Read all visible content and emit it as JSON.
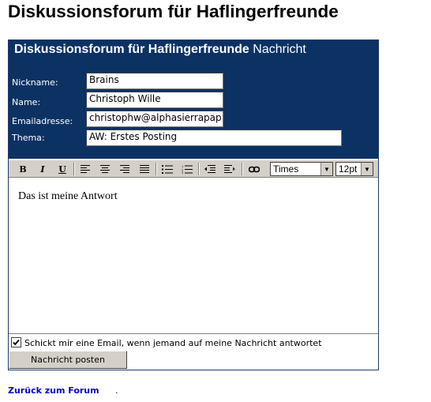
{
  "page": {
    "title": "Diskussionsforum für Haflingerfreunde"
  },
  "form": {
    "header_title": "Diskussionsforum für Haflingerfreunde",
    "header_subtitle": "Nachricht",
    "fields": {
      "nickname": {
        "label": "Nickname:",
        "value": "Brains"
      },
      "name": {
        "label": "Name:",
        "value": "Christoph Wille"
      },
      "email": {
        "label": "Emailadresse:",
        "value": "christophw@alphasierrapap"
      },
      "subject": {
        "label": "Thema:",
        "value": "AW: Erstes Posting"
      }
    },
    "toolbar": {
      "bold": "B",
      "italic": "I",
      "underline": "U",
      "font_select": "Times",
      "size_select": "12pt"
    },
    "editor_text": "Das ist meine Antwort",
    "notify_checkbox": {
      "label": "Schickt mir eine Email, wenn jemand auf meine Nachricht antwortet",
      "checked": true
    },
    "submit_label": "Nachricht posten"
  },
  "footer": {
    "back_link": "Zurück zum Forum",
    "back_suffix": "."
  }
}
